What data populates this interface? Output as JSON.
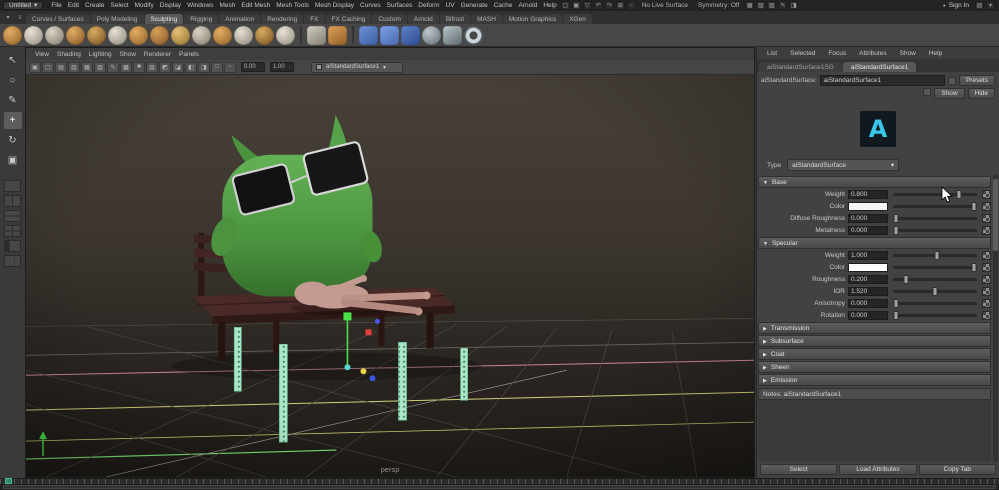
{
  "menubar": {
    "workspace": "Untitled",
    "menus": [
      "File",
      "Edit",
      "Create",
      "Select",
      "Modify",
      "Display",
      "Windows",
      "Mesh",
      "Edit Mesh",
      "Mesh Tools",
      "Mesh Display",
      "Curves",
      "Surfaces",
      "Deform",
      "UV",
      "Generate",
      "Cache",
      "Arnold",
      "Help"
    ],
    "icons_left": [
      {
        "name": "new-scene-icon",
        "glyph": "▢"
      },
      {
        "name": "open-scene-icon",
        "glyph": "▣"
      },
      {
        "name": "save-scene-icon",
        "glyph": "▽"
      },
      {
        "name": "undo-icon",
        "glyph": "↶"
      },
      {
        "name": "redo-icon",
        "glyph": "↷"
      },
      {
        "name": "snap-to-grid-icon",
        "glyph": "⊞"
      },
      {
        "name": "snap-to-point-icon",
        "glyph": "◦"
      }
    ],
    "no_live_surface": "No Live Surface",
    "symmetry": "Symmetry: Off",
    "icons_mid": [
      {
        "name": "render-icon",
        "glyph": "▦"
      },
      {
        "name": "ipr-render-icon",
        "glyph": "▧"
      },
      {
        "name": "render-settings-icon",
        "glyph": "▨"
      },
      {
        "name": "paint-effects-icon",
        "glyph": "✎"
      },
      {
        "name": "hypershade-icon",
        "glyph": "◨"
      }
    ],
    "sign_in": "Sign In",
    "icons_right": [
      {
        "name": "workspace-menu-icon",
        "glyph": "▤"
      },
      {
        "name": "collapse-menubar-icon",
        "glyph": "▾"
      }
    ]
  },
  "shelf": {
    "menu_icons": [
      {
        "name": "shelf-menu-icon",
        "glyph": "▾"
      },
      {
        "name": "shelf-edit-icon",
        "glyph": "≡"
      }
    ],
    "tabs": [
      {
        "label": "Curves / Surfaces"
      },
      {
        "label": "Poly Modeling"
      },
      {
        "label": "Sculpting",
        "active": true
      },
      {
        "label": "Rigging"
      },
      {
        "label": "Animation"
      },
      {
        "label": "Rendering"
      },
      {
        "label": "FX"
      },
      {
        "label": "FX Caching"
      },
      {
        "label": "Custom"
      },
      {
        "label": "Arnold"
      },
      {
        "label": "Bifrost"
      },
      {
        "label": "MASH"
      },
      {
        "label": "Motion Graphics"
      },
      {
        "label": "XGen"
      }
    ],
    "icons": [
      {
        "name": "sculpt-brush-icon",
        "shape": "circle",
        "c1": "#e2ad62",
        "c2": "#8e5e26"
      },
      {
        "name": "smooth-brush-icon",
        "shape": "circle",
        "c1": "#e9e3d5",
        "c2": "#8e897c"
      },
      {
        "name": "relax-brush-icon",
        "shape": "circle",
        "c1": "#d9d3c5",
        "c2": "#7d7868"
      },
      {
        "name": "grab-brush-icon",
        "shape": "circle",
        "c1": "#e2ad62",
        "c2": "#7d5222"
      },
      {
        "name": "pinch-brush-icon",
        "shape": "circle",
        "c1": "#d9a95e",
        "c2": "#6f4e20"
      },
      {
        "name": "flatten-brush-icon",
        "shape": "circle",
        "c1": "#e6e0d2",
        "c2": "#8a8578"
      },
      {
        "name": "foamy-brush-icon",
        "shape": "circle",
        "c1": "#e2ad62",
        "c2": "#8e5e26"
      },
      {
        "name": "spray-brush-icon",
        "shape": "circle",
        "c1": "#d9a05a",
        "c2": "#7d5222"
      },
      {
        "name": "repeat-brush-icon",
        "shape": "circle",
        "c1": "#e6c077",
        "c2": "#8e6e2a"
      },
      {
        "name": "imprint-brush-icon",
        "shape": "circle",
        "c1": "#d9d3c5",
        "c2": "#7d7868"
      },
      {
        "name": "wax-brush-icon",
        "shape": "circle",
        "c1": "#e2ad62",
        "c2": "#8e5e26"
      },
      {
        "name": "scrape-brush-icon",
        "shape": "circle",
        "c1": "#e6e0d2",
        "c2": "#8a8578"
      },
      {
        "name": "fill-brush-icon",
        "shape": "circle",
        "c1": "#d9a95e",
        "c2": "#6f4e20"
      },
      {
        "name": "knife-brush-icon",
        "shape": "circle",
        "c1": "#e9e3d5",
        "c2": "#8e897c"
      },
      {
        "name": "shelf-separator",
        "shape": "sep"
      },
      {
        "name": "xray-toggle-icon",
        "shape": "square",
        "c1": "#d2cdc0",
        "c2": "#837e72"
      },
      {
        "name": "sculpt-falloff-icon",
        "shape": "square",
        "c1": "#e2a159",
        "c2": "#8e5e26"
      },
      {
        "name": "shelf-separator",
        "shape": "sep"
      },
      {
        "name": "frame-selection-icon",
        "shape": "square",
        "c1": "#6e92d6",
        "c2": "#3c5ca2"
      },
      {
        "name": "uv-editor-icon",
        "shape": "square",
        "c1": "#7ba1e8",
        "c2": "#4a6ab0"
      },
      {
        "name": "grid-toggle-icon",
        "shape": "square",
        "c1": "#5d82ca",
        "c2": "#2e4c92"
      },
      {
        "name": "sphere-primitive-icon",
        "shape": "circle",
        "c1": "#bcc6cb",
        "c2": "#5d686d"
      },
      {
        "name": "cube-primitive-icon",
        "shape": "square",
        "c1": "#bcc6cb",
        "c2": "#5d686d"
      },
      {
        "name": "torus-primitive-icon",
        "shape": "ring",
        "c1": "#cdd6da",
        "c2": "#5d686d"
      }
    ]
  },
  "toolbox": {
    "tools": [
      {
        "name": "select-tool",
        "glyph": "↖"
      },
      {
        "name": "lasso-select-tool",
        "glyph": "○"
      },
      {
        "name": "paint-select-tool",
        "glyph": "✎"
      },
      {
        "name": "move-tool",
        "glyph": "+",
        "active": true
      },
      {
        "name": "rotate-tool",
        "glyph": "↻"
      },
      {
        "name": "scale-tool",
        "glyph": "▣"
      }
    ]
  },
  "viewport": {
    "menus": [
      "View",
      "Shading",
      "Lighting",
      "Show",
      "Renderer",
      "Panels"
    ],
    "toolbar_icons": [
      {
        "name": "view-cube-icon",
        "glyph": "▣"
      },
      {
        "name": "lock-camera-icon",
        "glyph": "▢"
      },
      {
        "name": "camera-attributes-icon",
        "glyph": "▤"
      },
      {
        "name": "bookmarks-icon",
        "glyph": "▥"
      },
      {
        "name": "image-plane-icon",
        "glyph": "▦"
      },
      {
        "name": "pan-zoom-icon",
        "glyph": "▧"
      },
      {
        "name": "grease-pencil-icon",
        "glyph": "✎"
      },
      {
        "name": "wireframe-mode-icon",
        "glyph": "▩"
      },
      {
        "name": "shaded-mode-icon",
        "glyph": "■"
      },
      {
        "name": "textured-mode-icon",
        "glyph": "▨"
      },
      {
        "name": "lighting-toggle-icon",
        "glyph": "◩"
      },
      {
        "name": "shadows-toggle-icon",
        "glyph": "◪"
      },
      {
        "name": "screen-ao-icon",
        "glyph": "◧"
      },
      {
        "name": "motion-blur-icon",
        "glyph": "◨"
      },
      {
        "name": "isolate-select-icon",
        "glyph": "□"
      },
      {
        "name": "xray-mode-icon",
        "glyph": "▫"
      }
    ],
    "exposure": "0.00",
    "gamma": "1.00",
    "dropdown_value": "aiStandardSurface1",
    "camera_label": "persp"
  },
  "attribute_editor": {
    "menu": [
      "List",
      "Selected",
      "Focus",
      "Attributes",
      "Show",
      "Help"
    ],
    "tabs": [
      {
        "label": "aiStandardSurface1SG"
      },
      {
        "label": "aiStandardSurface1",
        "active": true
      }
    ],
    "name_label": "aiStandardSurface:",
    "name_value": "aiStandardSurface1",
    "presets_button": "Presets",
    "show_button": "Show",
    "hide_button": "Hide",
    "logo_glyph": "A",
    "type_label": "Type",
    "type_value": "aiStandardSurface",
    "sections": [
      {
        "title": "Base",
        "rows": [
          {
            "label": "Weight",
            "value": "0.800"
          },
          {
            "label": "Color",
            "swatch": "#f5f5f5"
          },
          {
            "label": "Diffuse Roughness",
            "value": "0.000"
          },
          {
            "label": "Metalness",
            "value": "0.000"
          }
        ]
      },
      {
        "title": "Specular",
        "rows": [
          {
            "label": "Weight",
            "value": "1.000"
          },
          {
            "label": "Color",
            "swatch": "#ffffff"
          },
          {
            "label": "Roughness",
            "value": "0.200"
          },
          {
            "label": "IOR",
            "value": "1.520"
          },
          {
            "label": "Anisotropy",
            "value": "0.000"
          },
          {
            "label": "Rotation",
            "value": "0.000"
          }
        ]
      },
      {
        "title": "Transmission"
      },
      {
        "title": "Subsurface"
      },
      {
        "title": "Coat"
      },
      {
        "title": "Sheen"
      },
      {
        "title": "Emission"
      }
    ],
    "notes_label": "Notes: aiStandardSurface1",
    "footer_buttons": [
      "Select",
      "Load Attributes",
      "Copy Tab"
    ]
  }
}
